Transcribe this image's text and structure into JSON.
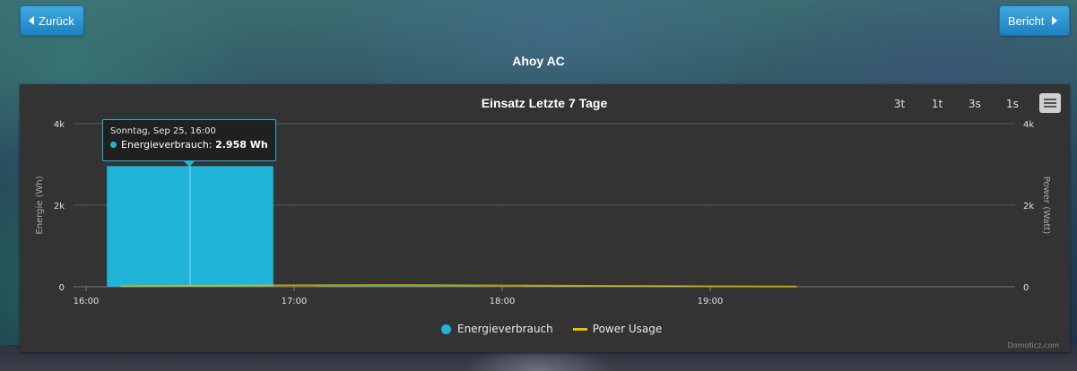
{
  "nav": {
    "back_label": "Zurück",
    "next_label": "Bericht"
  },
  "device": {
    "name": "Ahoy AC"
  },
  "chart": {
    "title": "Einsatz Letzte 7 Tage",
    "range_buttons": [
      "3t",
      "1t",
      "3s",
      "1s"
    ],
    "credits": "Domoticz.com",
    "tooltip": {
      "header": "Sonntag, Sep 25, 16:00",
      "series": "Energieverbrauch",
      "value": "2.958 Wh"
    },
    "legend": [
      {
        "name": "Energieverbrauch",
        "color": "#1fb4d8",
        "marker": "dot"
      },
      {
        "name": "Power Usage",
        "color": "#e0c000",
        "marker": "line"
      }
    ]
  },
  "chart_data": {
    "type": "bar",
    "ylabel": "Energie (Wh)",
    "y2label": "Power (Watt)",
    "ylim": [
      0,
      4000
    ],
    "y_ticks": [
      "0",
      "2k",
      "4k"
    ],
    "x_ticks": [
      "16:00",
      "17:00",
      "18:00",
      "19:00"
    ],
    "grid": true,
    "legend_position": "bottom",
    "series": [
      {
        "name": "Energieverbrauch",
        "type": "bar",
        "color": "#1fb4d8",
        "points": [
          {
            "start": "16:06",
            "end": "16:54",
            "value": 2958
          },
          {
            "start": "17:06",
            "end": "17:54",
            "value": 20
          },
          {
            "start": "18:06",
            "end": "18:54",
            "value": 25
          }
        ]
      },
      {
        "name": "Power Usage",
        "type": "line",
        "color": "#e0c000",
        "points": [
          {
            "x": "16:10",
            "y": 15
          },
          {
            "x": "17:00",
            "y": 35
          },
          {
            "x": "17:30",
            "y": 40
          },
          {
            "x": "18:00",
            "y": 30
          },
          {
            "x": "18:30",
            "y": 20
          },
          {
            "x": "19:00",
            "y": 10
          },
          {
            "x": "19:25",
            "y": 5
          }
        ]
      }
    ]
  }
}
